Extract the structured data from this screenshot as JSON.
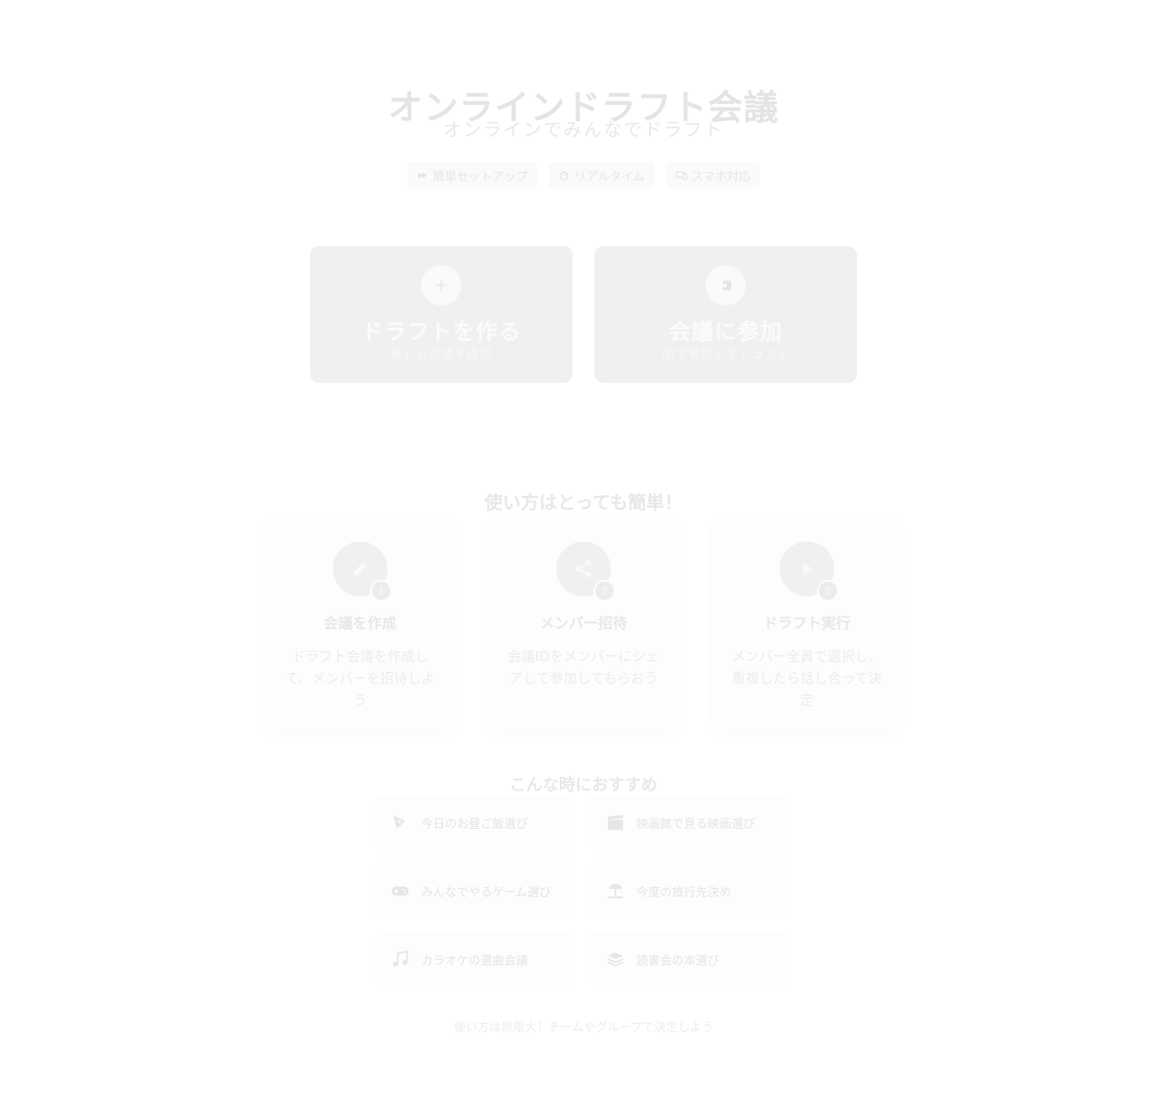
{
  "hero": {
    "title": "オンラインドラフト会議",
    "subtitle": "オンラインでみんなでドラフト",
    "badges": [
      {
        "icon": "fast-forward-icon",
        "label": "簡単セットアップ"
      },
      {
        "icon": "speed-icon",
        "label": "リアルタイム"
      },
      {
        "icon": "devices-icon",
        "label": "スマホ対応"
      }
    ]
  },
  "actions": {
    "create": {
      "icon": "plus-icon",
      "title": "ドラフトを作る",
      "desc": "新しい会議を作成"
    },
    "join": {
      "icon": "login-icon",
      "title": "会議に参加",
      "desc": "IDで参加してドラフト"
    }
  },
  "howto": {
    "title": "使い方はとっても簡単！",
    "steps": [
      {
        "num": "1",
        "icon": "pencil-icon",
        "title": "会議を作成",
        "desc": "ドラフト会議を作成して、メンバーを招待しよう"
      },
      {
        "num": "2",
        "icon": "share-icon",
        "title": "メンバー招待",
        "desc": "会議IDをメンバーにシェアして参加してもらおう"
      },
      {
        "num": "3",
        "icon": "play-icon",
        "title": "ドラフト実行",
        "desc": "メンバー全員で選択し、重複したら話し合って決定"
      }
    ]
  },
  "recommend": {
    "title": "こんな時におすすめ",
    "items": [
      {
        "icon": "food-icon",
        "label": "今日のお昼ご飯選び"
      },
      {
        "icon": "movie-icon",
        "label": "映画館で見る映画選び"
      },
      {
        "icon": "gamepad-icon",
        "label": "みんなでやるゲーム選び"
      },
      {
        "icon": "beach-icon",
        "label": "今度の旅行先決め"
      },
      {
        "icon": "music-note-icon",
        "label": "カラオケの選曲会議"
      },
      {
        "icon": "book-stack-icon",
        "label": "読書会の本選び"
      }
    ]
  },
  "footer": {
    "text": "使い方は無限大！チームやグループで決定しよう"
  }
}
